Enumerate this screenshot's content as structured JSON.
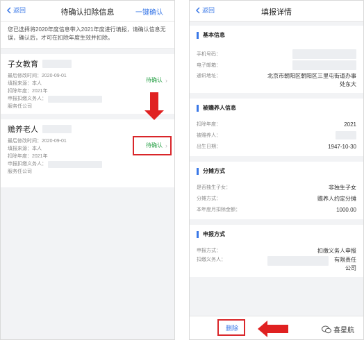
{
  "left": {
    "back_label": "返回",
    "title": "待确认扣除信息",
    "confirm_all": "一键确认",
    "notice": "您已选择将2020年度信息带入2021年度进行填报，请确认信息无误，确认后，才可在扣除年度生效并扣除。",
    "cards": [
      {
        "title": "子女教育",
        "updated_label": "最后修改时间：",
        "updated_value": "2020-09-01",
        "source_label": "填报来源：",
        "source_value": "本人",
        "year_label": "扣除年度：",
        "year_value": "2021年",
        "employer_label": "申报扣缴义务人：",
        "employer_value": "",
        "status": "待确认"
      },
      {
        "title": "赡养老人",
        "updated_label": "最后修改时间：",
        "updated_value": "2020-09-01",
        "source_label": "填报来源：",
        "source_value": "本人",
        "year_label": "扣除年度：",
        "year_value": "2021年",
        "employer_label": "申报扣缴义务人：",
        "employer_value": "服务任公司",
        "status": "待确认"
      }
    ],
    "card1_employer_suffix": "服务任公司"
  },
  "right": {
    "back_label": "返回",
    "title": "填报详情",
    "sections": {
      "basic": {
        "heading": "基本信息",
        "phone_label": "手机号码：",
        "email_label": "电子邮箱：",
        "address_label": "通讯地址：",
        "address_value": "北京市朝阳区朝阳区三里屯街道办事处东大"
      },
      "elder": {
        "heading": "被赡养人信息",
        "year_label": "扣除年度：",
        "year_value": "2021",
        "name_label": "被赡养人：",
        "dob_label": "出生日期：",
        "dob_value": "1947-10-30"
      },
      "split": {
        "heading": "分摊方式",
        "only_child_label": "是否独生子女：",
        "only_child_value": "非独生子女",
        "method_label": "分摊方式：",
        "method_value": "赡养人约定分摊",
        "amount_label": "本年度月扣除金额：",
        "amount_value": "1000.00"
      },
      "report": {
        "heading": "申报方式",
        "method_label": "申报方式：",
        "method_value": "扣缴义务人申报",
        "agent_label": "扣缴义务人：",
        "agent_value": "有限责任公司"
      }
    },
    "delete_label": "删除"
  },
  "watermark": "喜星航",
  "colors": {
    "accent": "#3a78e7",
    "pending": "#2aa148",
    "highlight": "#d9262a"
  }
}
